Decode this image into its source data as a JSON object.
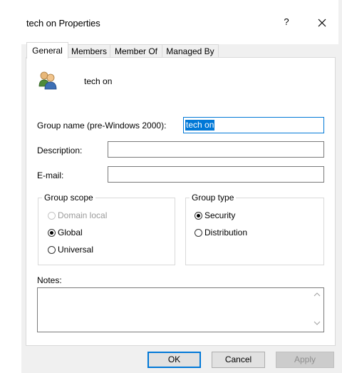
{
  "window": {
    "title": "tech on Properties",
    "help_glyph": "?",
    "close_glyph": "✕"
  },
  "tabs": [
    {
      "label": "General",
      "active": true
    },
    {
      "label": "Members",
      "active": false
    },
    {
      "label": "Member Of",
      "active": false
    },
    {
      "label": "Managed By",
      "active": false
    }
  ],
  "general": {
    "group_display_name": "tech on",
    "group_name_label": "Group name (pre-Windows 2000):",
    "group_name_value": "tech on",
    "description_label": "Description:",
    "description_value": "",
    "email_label": "E-mail:",
    "email_value": "",
    "group_scope": {
      "legend": "Group scope",
      "options": [
        {
          "label": "Domain local",
          "checked": false,
          "disabled": true
        },
        {
          "label": "Global",
          "checked": true,
          "disabled": false
        },
        {
          "label": "Universal",
          "checked": false,
          "disabled": false
        }
      ]
    },
    "group_type": {
      "legend": "Group type",
      "options": [
        {
          "label": "Security",
          "checked": true
        },
        {
          "label": "Distribution",
          "checked": false
        }
      ]
    },
    "notes_label": "Notes:",
    "notes_value": ""
  },
  "buttons": {
    "ok": "OK",
    "cancel": "Cancel",
    "apply": "Apply"
  },
  "icons": {
    "group": "group-icon",
    "close": "close-icon",
    "help": "help-icon",
    "scroll_up": "scroll-up-arrow-icon",
    "scroll_down": "scroll-down-arrow-icon"
  },
  "colors": {
    "selection": "#0078d7",
    "panel": "#f0f0f0"
  }
}
